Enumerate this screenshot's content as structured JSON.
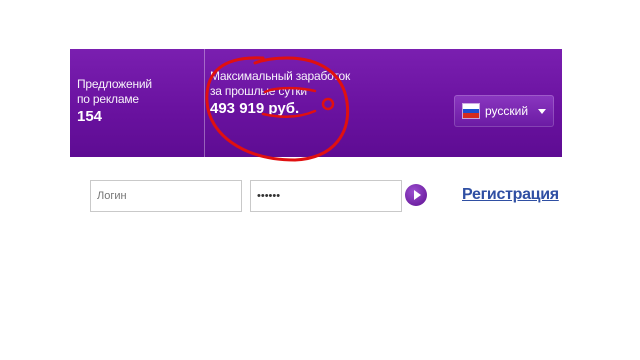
{
  "stats": {
    "offers_label_line1": "Предложений",
    "offers_label_line2": "по рекламе",
    "offers_value": "154",
    "earnings_label_line1": "Максимальный заработок",
    "earnings_label_line2": "за прошлые сутки",
    "earnings_value": "493 919 руб."
  },
  "language": {
    "selected": "русский",
    "icon": "russia-flag-icon"
  },
  "login": {
    "username_placeholder": "Логин",
    "password_value": "••••••"
  },
  "actions": {
    "register_label": "Регистрация"
  },
  "colors": {
    "banner": "#6a12a0",
    "link": "#2f4fa3",
    "annotation": "#e01010"
  }
}
